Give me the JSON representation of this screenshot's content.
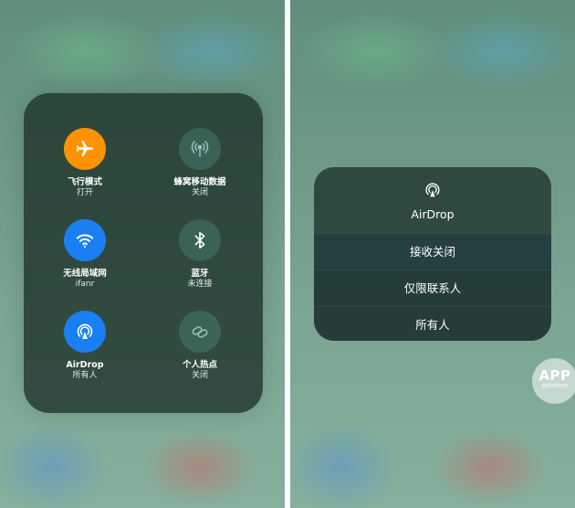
{
  "left": {
    "toggles": [
      {
        "title": "飞行模式",
        "sub": "打开",
        "icon": "airplane-icon",
        "color": "#fe9200"
      },
      {
        "title": "蜂窝移动数据",
        "sub": "关闭",
        "icon": "cellular-antenna-icon",
        "color": "#4a7a70"
      },
      {
        "title": "无线局域网",
        "sub": "ifanr",
        "icon": "wifi-icon",
        "color": "#1a7ff2"
      },
      {
        "title": "蓝牙",
        "sub": "未连接",
        "icon": "bluetooth-icon",
        "color": "#4a7a70"
      },
      {
        "title": "AirDrop",
        "sub": "所有人",
        "icon": "airdrop-icon",
        "color": "#1a7ff2"
      },
      {
        "title": "个人热点",
        "sub": "关闭",
        "icon": "hotspot-link-icon",
        "color": "#4a7a70"
      }
    ]
  },
  "right": {
    "title": "AirDrop",
    "icon": "airdrop-icon",
    "items": [
      "接收关闭",
      "仅限联系人",
      "所有人"
    ]
  },
  "badge": {
    "line1": "APP",
    "line2": "solution"
  }
}
